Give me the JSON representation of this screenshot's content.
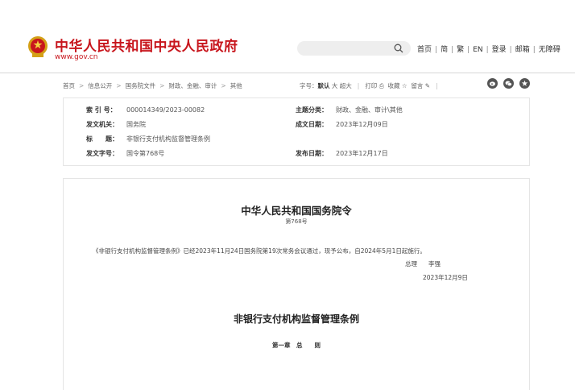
{
  "header": {
    "site_title": "中华人民共和国中央人民政府",
    "site_url": "www.gov.cn",
    "search_placeholder": "",
    "nav": [
      "首页",
      "简",
      "繁",
      "EN",
      "登录",
      "邮箱",
      "无障碍"
    ]
  },
  "breadcrumb": [
    "首页",
    "信息公开",
    "国务院文件",
    "财政、金融、审计",
    "其他"
  ],
  "tools": {
    "font_label": "字号：",
    "font_default": "默认",
    "font_large": "大",
    "font_xlarge": "超大",
    "print": "打印",
    "favorite": "收藏",
    "message": "留言"
  },
  "info": {
    "index_label": "索 引 号：",
    "index_value": "000014349/2023-00082",
    "category_label": "主题分类：",
    "category_value": "财政、金融、审计\\其他",
    "issuer_label": "发文机关：",
    "issuer_value": "国务院",
    "written_label": "成文日期：",
    "written_value": "2023年12月09日",
    "title_label": "标　　题：",
    "title_value": "非银行支付机构监督管理条例",
    "docno_label": "发文字号：",
    "docno_value": "国令第768号",
    "published_label": "发布日期：",
    "published_value": "2023年12月17日"
  },
  "article": {
    "title": "中华人民共和国国务院令",
    "number": "第768号",
    "body": "《非银行支付机构监督管理条例》已经2023年11月24日国务院第19次常务会议通过，现予公布，自2024年5月1日起施行。",
    "sign_title": "总理",
    "sign_name": "李强",
    "sign_date": "2023年12月9日",
    "regulation_title": "非银行支付机构监督管理条例",
    "chapter": "第一章　总　　则"
  },
  "colors": {
    "brand_red": "#c8161d",
    "share_icons": "#555555"
  }
}
